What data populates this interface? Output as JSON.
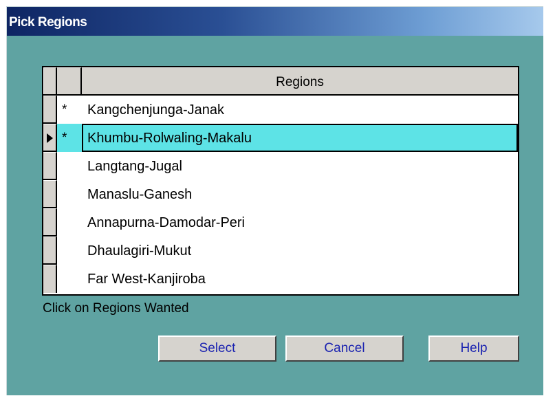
{
  "window": {
    "title": "Pick Regions"
  },
  "grid": {
    "column_header": "Regions",
    "rows": [
      {
        "marker": "*",
        "name": "Kangchenjunga-Janak"
      },
      {
        "marker": "*",
        "name": "Khumbu-Rolwaling-Makalu"
      },
      {
        "marker": "",
        "name": "Langtang-Jugal"
      },
      {
        "marker": "",
        "name": "Manaslu-Ganesh"
      },
      {
        "marker": "",
        "name": "Annapurna-Damodar-Peri"
      },
      {
        "marker": "",
        "name": "Dhaulagiri-Mukut"
      },
      {
        "marker": "",
        "name": "Far West-Kanjiroba"
      }
    ],
    "current_row": "Khumbu-Rolwaling-Makalu"
  },
  "hint": "Click on Regions Wanted",
  "buttons": {
    "select": "Select",
    "cancel": "Cancel",
    "help": "Help"
  },
  "colors": {
    "selection": "#5de3e6",
    "dialog_bg": "#5fa3a2",
    "button_text": "#1a22b0",
    "title_bar": "#0e2563"
  }
}
